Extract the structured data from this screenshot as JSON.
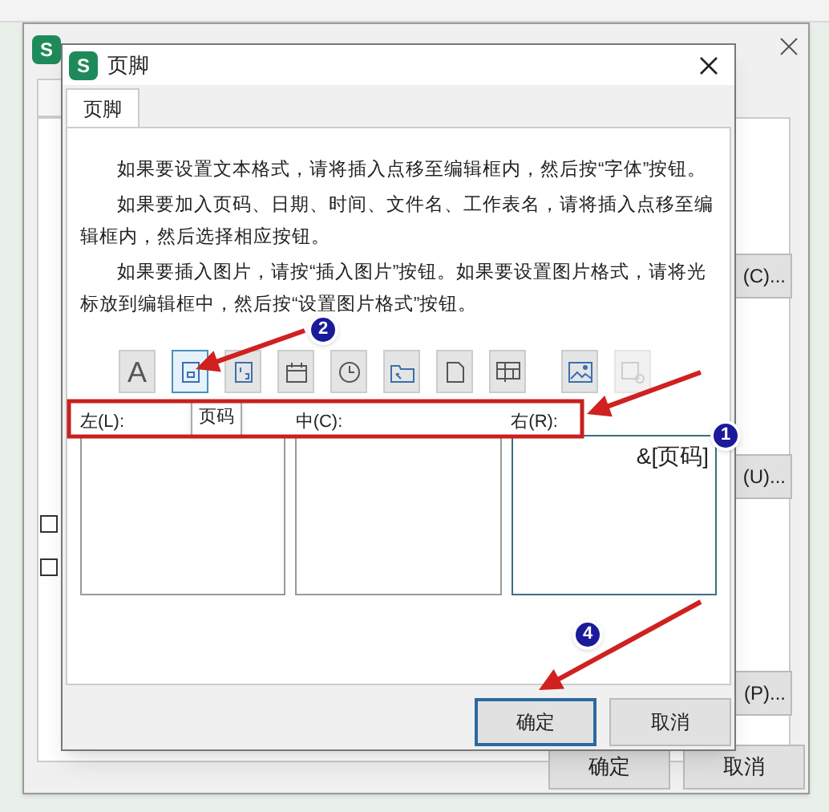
{
  "back_dialog": {
    "logo": "S",
    "checkboxes": [
      {
        "checked": false
      },
      {
        "checked": false
      }
    ],
    "side_buttons": [
      "(C)...",
      "(U)...",
      "(P)..."
    ],
    "buttons": [
      "确定",
      "取消"
    ]
  },
  "dialog": {
    "logo": "S",
    "title": "页脚",
    "tabs": [
      {
        "label": "页脚",
        "selected": true
      }
    ],
    "paragraphs": [
      "如果要设置文本格式，请将插入点移至编辑框内，然后按“字体”按钮。",
      "如果要加入页码、日期、时间、文件名、工作表名，请将插入点移至编辑框内，然后选择相应按钮。",
      "如果要插入图片，请按“插入图片”按钮。如果要设置图片格式，请将光标放到编辑框中，然后按“设置图片格式”按钮。"
    ],
    "toolbar": [
      {
        "kind": "font",
        "label": "A",
        "selected": false,
        "disabled": false
      },
      {
        "kind": "page-number",
        "selected": true,
        "disabled": false
      },
      {
        "kind": "page-count",
        "selected": false,
        "disabled": false
      },
      {
        "kind": "date",
        "selected": false,
        "disabled": false
      },
      {
        "kind": "time",
        "selected": false,
        "disabled": false
      },
      {
        "kind": "path",
        "selected": false,
        "disabled": false
      },
      {
        "kind": "file",
        "selected": false,
        "disabled": false
      },
      {
        "kind": "sheet",
        "selected": false,
        "disabled": false
      },
      {
        "kind": "picture",
        "selected": false,
        "disabled": false
      },
      {
        "kind": "picture-format",
        "selected": false,
        "disabled": true
      }
    ],
    "tooltip": "页码",
    "sections": [
      {
        "label": "左(L):",
        "selected": false
      },
      {
        "label": "中(C):",
        "selected": false
      },
      {
        "label": "右(R):",
        "value": "&[页码]",
        "selected": true
      }
    ],
    "buttons": [
      {
        "label": "确定",
        "selected": true
      },
      {
        "label": "取消",
        "selected": false
      }
    ]
  },
  "annotations": [
    "1",
    "2",
    "4"
  ]
}
